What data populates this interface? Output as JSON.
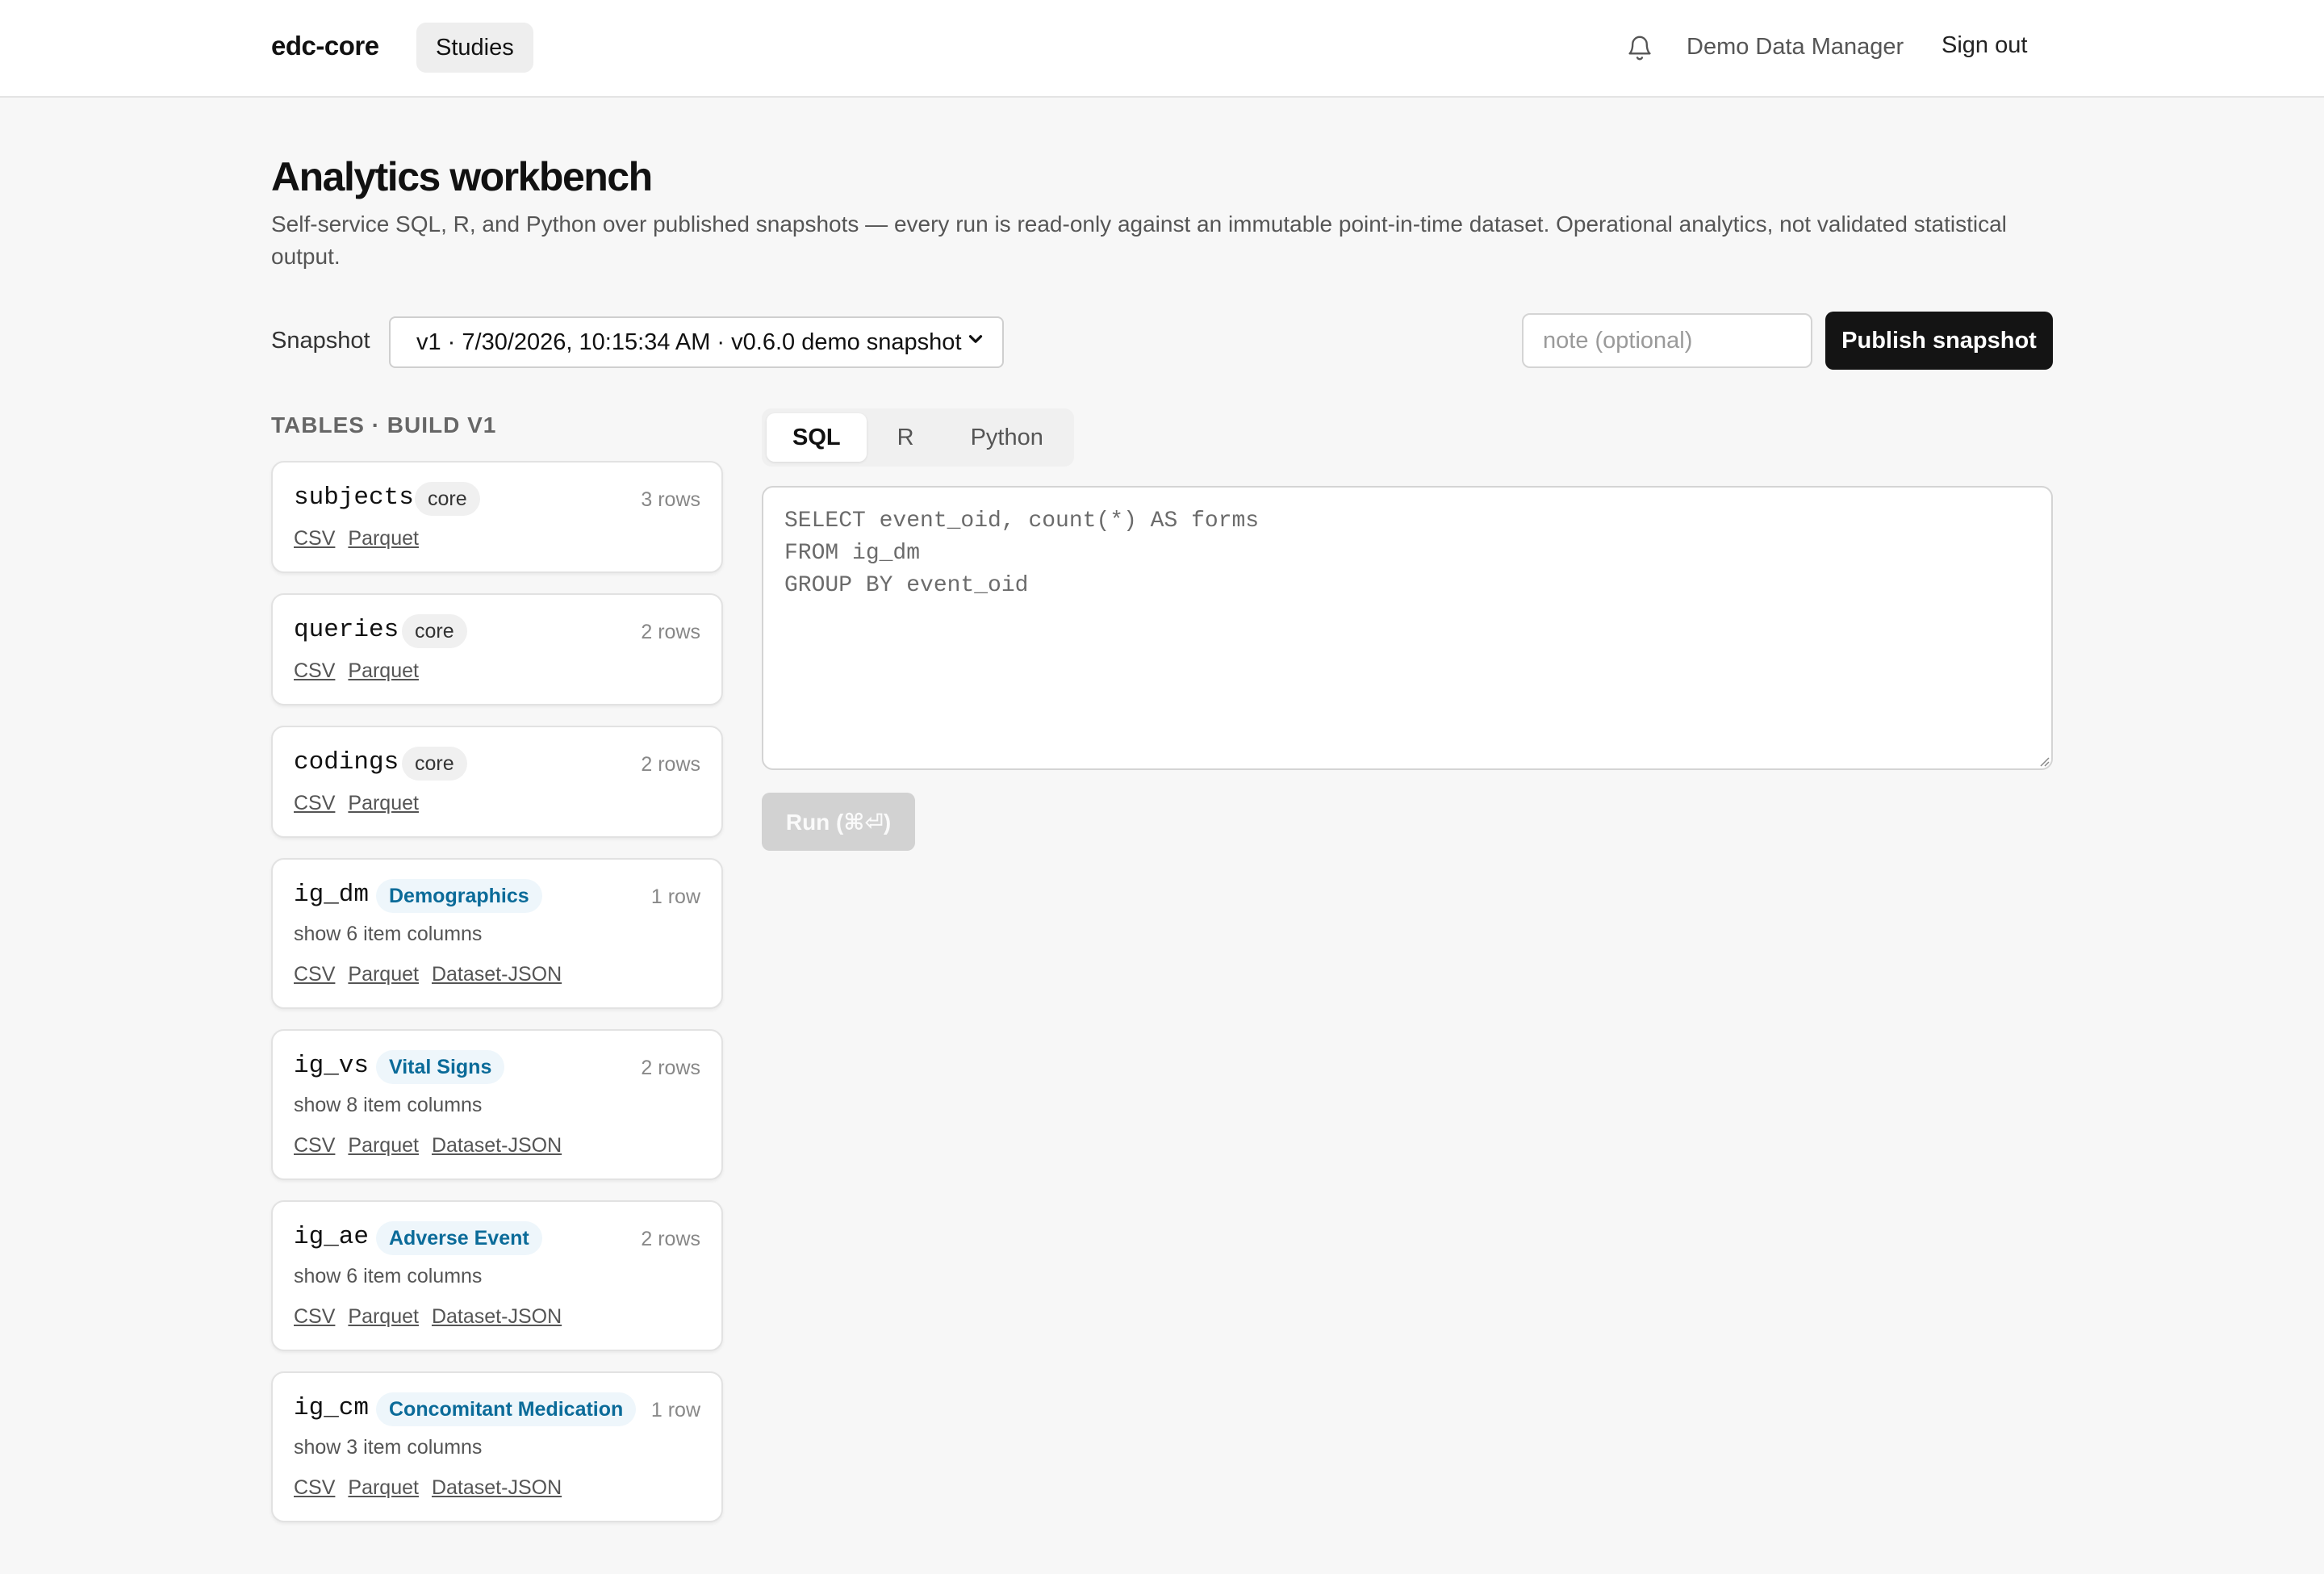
{
  "header": {
    "brand": "edc-core",
    "nav_studies": "Studies",
    "bell_icon": "bell-icon",
    "user_name": "Demo Data Manager",
    "sign_out": "Sign out"
  },
  "page": {
    "title": "Analytics workbench",
    "description": "Self-service SQL, R, and Python over published snapshots — every run is read-only against an immutable point-in-time dataset. Operational analytics, not validated statistical output."
  },
  "snapshot": {
    "label": "Snapshot",
    "selected": "v1 · 7/30/2026, 10:15:34 AM · v0.6.0 demo snapshot",
    "note_placeholder": "note (optional)",
    "publish_label": "Publish snapshot"
  },
  "tables": {
    "heading": "TABLES · BUILD V1",
    "items": [
      {
        "name": "subjects",
        "badge": "core",
        "rows": "3 rows",
        "links": [
          "CSV",
          "Parquet"
        ]
      },
      {
        "name": "queries",
        "badge": "core",
        "rows": "2 rows",
        "links": [
          "CSV",
          "Parquet"
        ]
      },
      {
        "name": "codings",
        "badge": "core",
        "rows": "2 rows",
        "links": [
          "CSV",
          "Parquet"
        ]
      },
      {
        "name": "ig_dm",
        "badge": "Demographics",
        "rows": "1 row",
        "columns": "show 6 item columns",
        "links": [
          "CSV",
          "Parquet",
          "Dataset-JSON"
        ]
      },
      {
        "name": "ig_vs",
        "badge": "Vital Signs",
        "rows": "2 rows",
        "columns": "show 8 item columns",
        "links": [
          "CSV",
          "Parquet",
          "Dataset-JSON"
        ]
      },
      {
        "name": "ig_ae",
        "badge": "Adverse Event",
        "rows": "2 rows",
        "columns": "show 6 item columns",
        "links": [
          "CSV",
          "Parquet",
          "Dataset-JSON"
        ]
      },
      {
        "name": "ig_cm",
        "badge": "Concomitant Medication",
        "rows": "1 row",
        "columns": "show 3 item columns",
        "links": [
          "CSV",
          "Parquet",
          "Dataset-JSON"
        ]
      }
    ]
  },
  "editor": {
    "tabs": [
      "SQL",
      "R",
      "Python"
    ],
    "active_tab": "SQL",
    "placeholder": "SELECT event_oid, count(*) AS forms\nFROM ig_dm\nGROUP BY event_oid",
    "run_label": "Run (⌘⏎)"
  },
  "colors": {
    "primary_button": "#141414",
    "form_badge_text": "#0b6b99",
    "form_badge_bg": "#eef6fb",
    "disabled_button": "#d2d2d2"
  }
}
